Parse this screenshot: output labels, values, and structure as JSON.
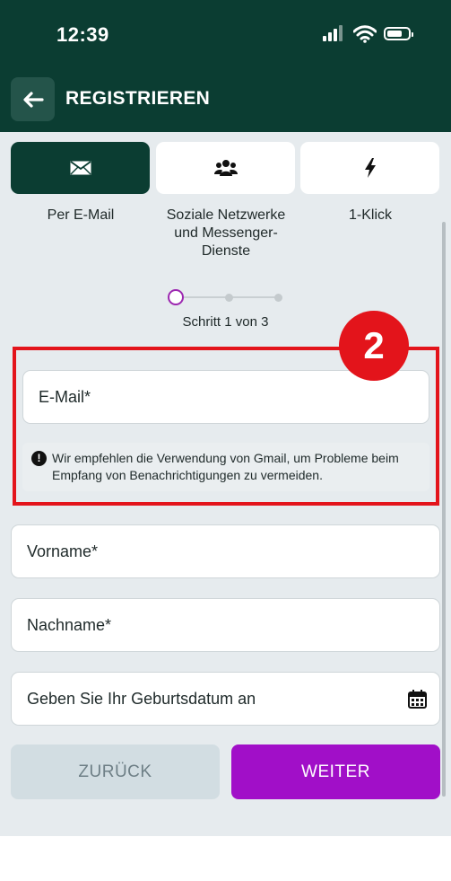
{
  "status_bar": {
    "time": "12:39",
    "icons": [
      "signal-icon",
      "wifi-icon",
      "battery-icon"
    ]
  },
  "header": {
    "title": "REGISTRIEREN",
    "back_icon": "arrow-left-icon"
  },
  "methods": [
    {
      "label": "Per E-Mail",
      "icon": "envelope-icon",
      "active": true
    },
    {
      "label": "Soziale Netzwerke und Messenger-Dienste",
      "icon": "users-icon",
      "active": false
    },
    {
      "label": "1-Klick",
      "icon": "lightning-icon",
      "active": false
    }
  ],
  "stepper": {
    "text": "Schritt 1 von 3",
    "current_step": 1,
    "total_steps": 3
  },
  "annotation": {
    "badge": "2"
  },
  "form": {
    "email_placeholder": "E-Mail*",
    "email_hint": "Wir empfehlen die Verwendung von Gmail, um Probleme beim Empfang von Benachrichtigungen zu vermeiden.",
    "firstname_placeholder": "Vorname*",
    "lastname_placeholder": "Nachname*",
    "birthdate_placeholder": "Geben Sie Ihr Geburtsdatum an"
  },
  "buttons": {
    "back_label": "ZURÜCK",
    "next_label": "WEITER"
  },
  "colors": {
    "header_bg": "#0b3d32",
    "accent": "#a10fc8",
    "highlight": "#e3141b",
    "content_bg": "#e6ebee"
  }
}
